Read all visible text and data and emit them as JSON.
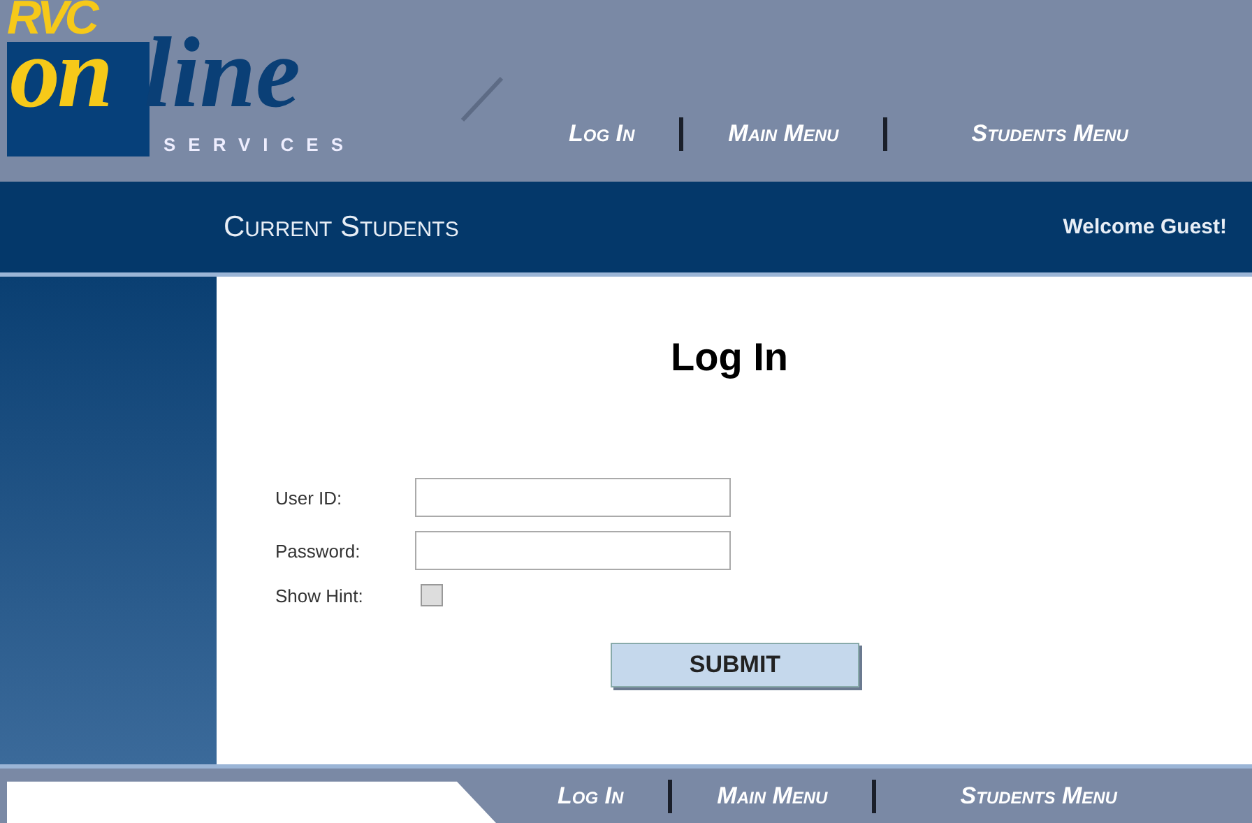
{
  "logo": {
    "top": "RVC",
    "highlight": "on",
    "rest": "line",
    "sub": "SERVICES"
  },
  "top_nav": [
    {
      "label": "Log In"
    },
    {
      "label": "Main Menu"
    },
    {
      "label": "Students Menu"
    }
  ],
  "banner": {
    "title": "Current Students",
    "greeting": "Welcome Guest!"
  },
  "login": {
    "heading": "Log In",
    "fields": [
      {
        "label": "User ID:",
        "kind": "text"
      },
      {
        "label": "Password:",
        "kind": "password"
      },
      {
        "label": "Show Hint:",
        "kind": "checkbox",
        "checked": false
      }
    ],
    "submit": "SUBMIT"
  },
  "bottom_nav": [
    {
      "label": "Log In"
    },
    {
      "label": "Main Menu"
    },
    {
      "label": "Students Menu"
    }
  ]
}
